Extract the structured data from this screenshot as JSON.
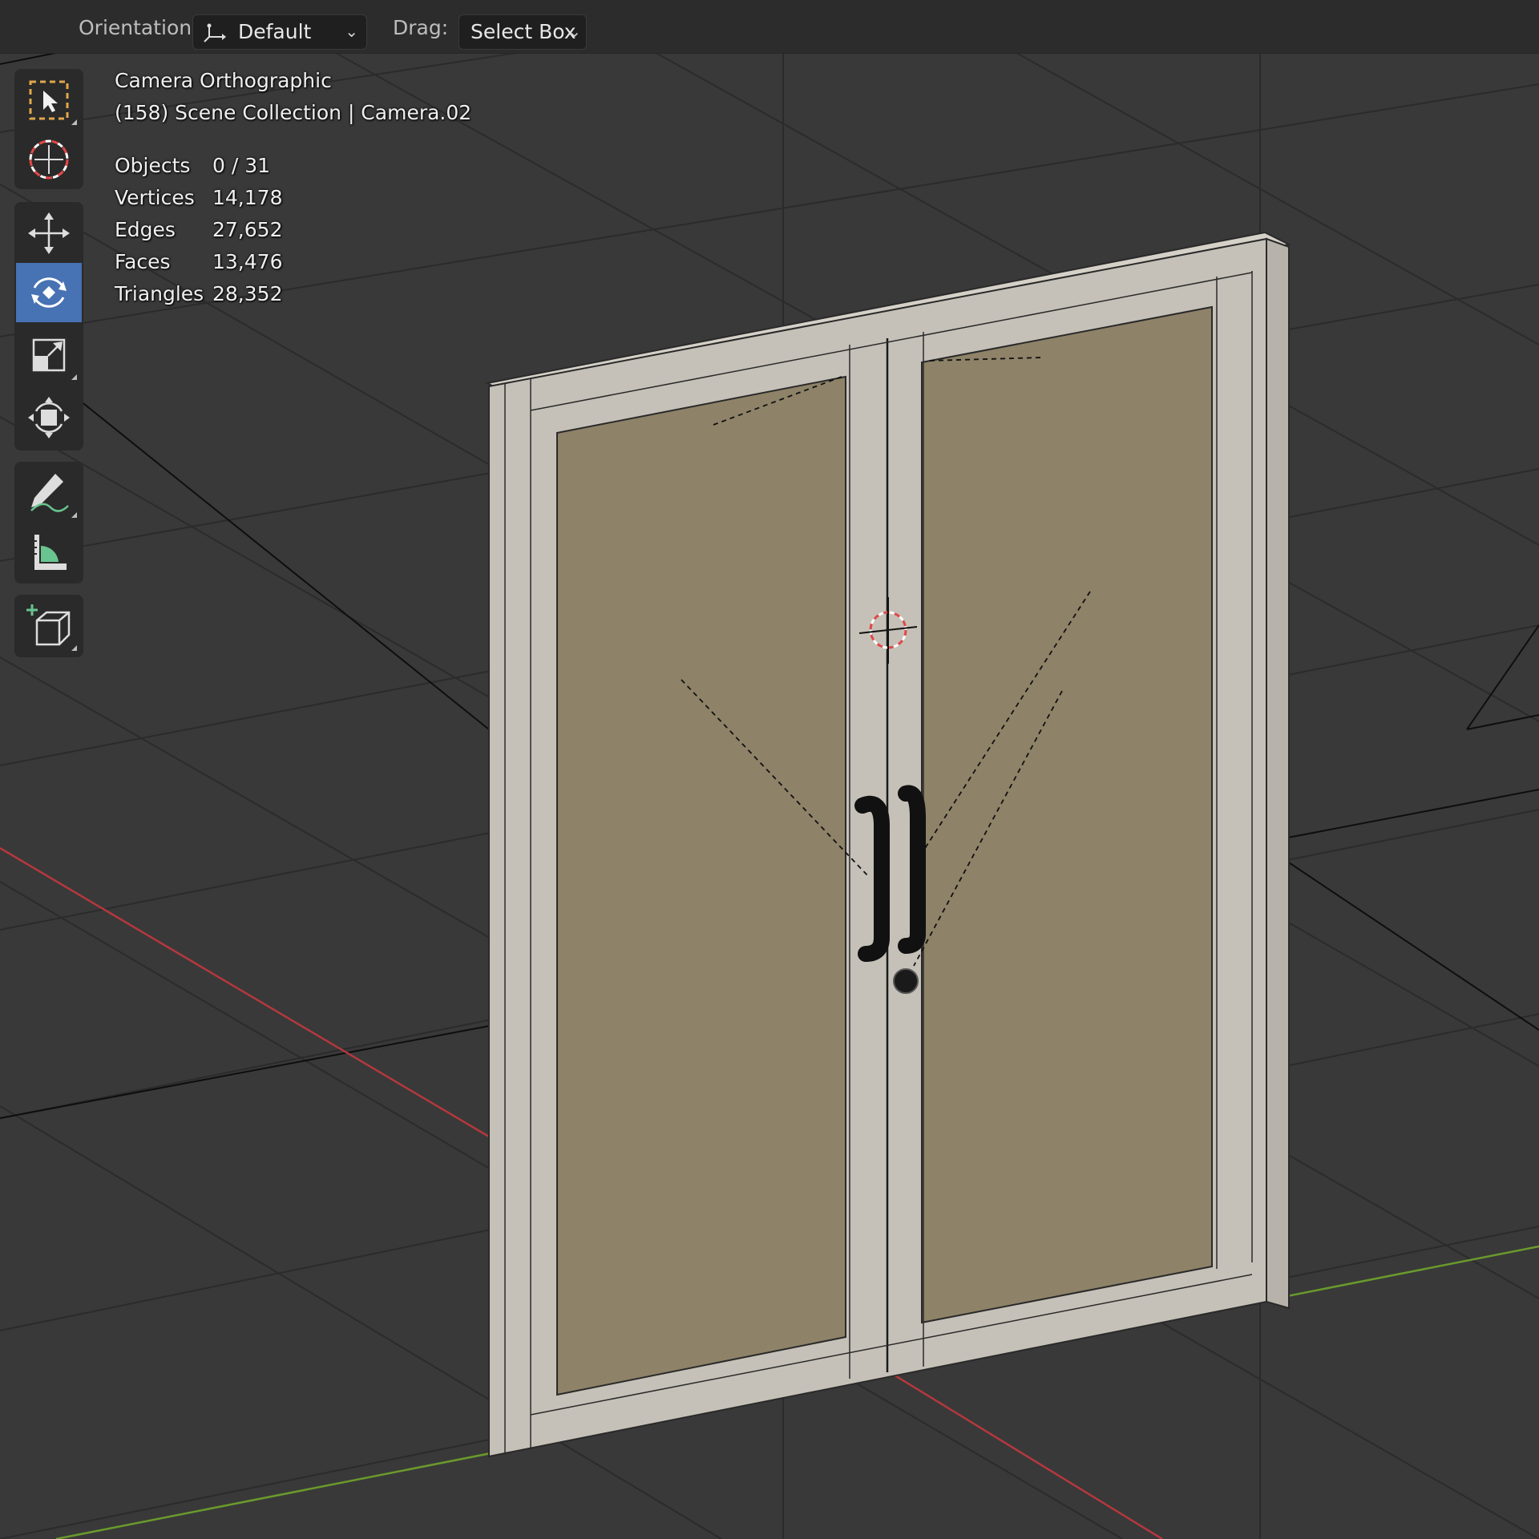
{
  "header": {
    "orientation_label": "Orientation:",
    "orientation_value": "Default",
    "drag_label": "Drag:",
    "drag_value": "Select Box"
  },
  "toolbar": {
    "tools": [
      {
        "name": "select-box",
        "icon": "select-box-icon",
        "active": false
      },
      {
        "name": "cursor",
        "icon": "cursor-icon",
        "active": false
      },
      {
        "name": "move",
        "icon": "move-icon",
        "active": false
      },
      {
        "name": "rotate",
        "icon": "rotate-icon",
        "active": true
      },
      {
        "name": "scale",
        "icon": "scale-icon",
        "active": false
      },
      {
        "name": "transform",
        "icon": "transform-icon",
        "active": false
      },
      {
        "name": "annotate",
        "icon": "annotate-icon",
        "active": false
      },
      {
        "name": "measure",
        "icon": "measure-icon",
        "active": false
      },
      {
        "name": "add-cube",
        "icon": "add-cube-icon",
        "active": false
      }
    ]
  },
  "overlay": {
    "view_name": "Camera Orthographic",
    "collection": "(158) Scene Collection | Camera.02",
    "stats": [
      {
        "label": "Objects",
        "value": "0 / 31"
      },
      {
        "label": "Vertices",
        "value": "14,178"
      },
      {
        "label": "Edges",
        "value": "27,652"
      },
      {
        "label": "Faces",
        "value": "13,476"
      },
      {
        "label": "Triangles",
        "value": "28,352"
      }
    ]
  },
  "colors": {
    "background": "#393939",
    "active_tool": "#4772b3",
    "door_frame": "#c6c1b8",
    "door_panel": "#8e8268",
    "x_axis": "#b3383e",
    "y_axis": "#6a9a2c",
    "handle": "#111111"
  }
}
